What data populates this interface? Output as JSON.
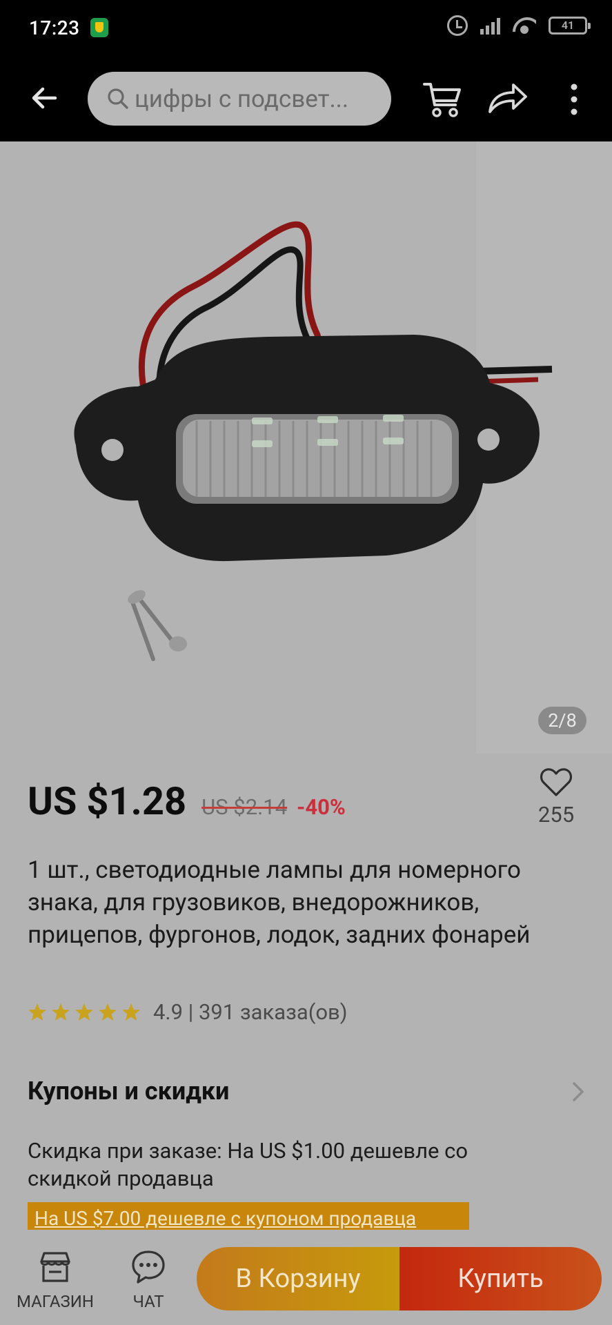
{
  "status_bar": {
    "time": "17:23",
    "battery": "41"
  },
  "header": {
    "search_text": "цифры с подсвет..."
  },
  "product": {
    "image_counter": "2/8",
    "price_current": "US $1.28",
    "price_old": "US $2.14",
    "discount": "-40%",
    "wishlist_count": "255",
    "title": "1 шт., светодиодные лампы для номерного знака, для грузовиков, внедорожников, прицепов, фургонов, лодок, задних фонарей",
    "rating_text": "4.9 | 391 заказа(ов)",
    "rating_stars": 5
  },
  "coupons": {
    "title": "Купоны и скидки",
    "note": "Скидка при заказе: На US $1.00 дешевле со скидкой продавца",
    "banner": "На US $7.00 дешевле с купоном продавца"
  },
  "bottom_bar": {
    "store_label": "МАГАЗИН",
    "chat_label": "ЧАТ",
    "add_cart_label": "В Корзину",
    "buy_label": "Купить"
  },
  "colors": {
    "discount": "#c9303b",
    "add_cart": "#c69a0b",
    "buy": "#c4280e",
    "star": "#c9a21e"
  }
}
